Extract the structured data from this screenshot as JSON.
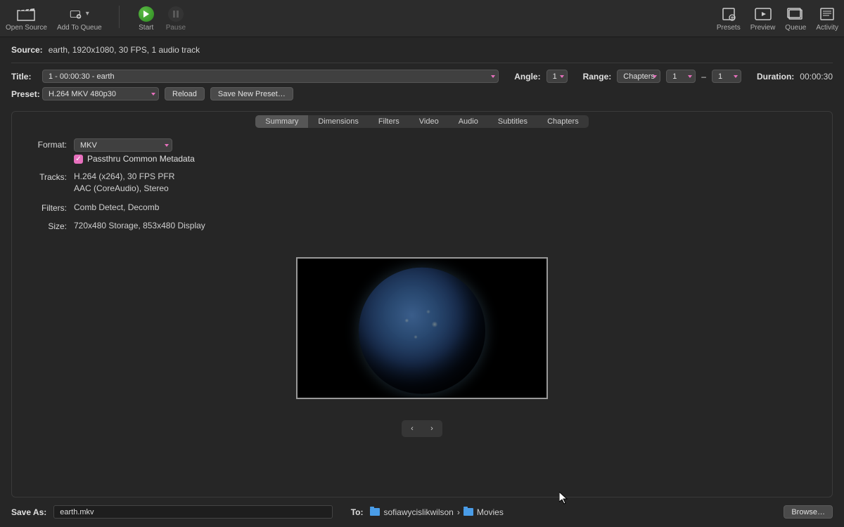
{
  "toolbar": {
    "open_source": "Open Source",
    "add_to_queue": "Add To Queue",
    "start": "Start",
    "pause": "Pause",
    "presets": "Presets",
    "preview": "Preview",
    "queue": "Queue",
    "activity": "Activity"
  },
  "source": {
    "label": "Source:",
    "value": "earth, 1920x1080, 30 FPS, 1 audio track"
  },
  "title": {
    "label": "Title:",
    "value": "1 - 00:00:30 - earth"
  },
  "angle": {
    "label": "Angle:",
    "value": "1"
  },
  "range": {
    "label": "Range:",
    "type": "Chapters",
    "from": "1",
    "to": "1",
    "sep": "–"
  },
  "duration": {
    "label": "Duration:",
    "value": "00:00:30"
  },
  "preset": {
    "label": "Preset:",
    "value": "H.264 MKV 480p30",
    "reload": "Reload",
    "save_new": "Save New Preset…"
  },
  "tabs": [
    "Summary",
    "Dimensions",
    "Filters",
    "Video",
    "Audio",
    "Subtitles",
    "Chapters"
  ],
  "active_tab": "Summary",
  "summary": {
    "format_label": "Format:",
    "format_value": "MKV",
    "passthru": "Passthru Common Metadata",
    "tracks_label": "Tracks:",
    "tracks_line1": "H.264 (x264), 30 FPS PFR",
    "tracks_line2": "AAC (CoreAudio), Stereo",
    "filters_label": "Filters:",
    "filters_value": "Comb Detect, Decomb",
    "size_label": "Size:",
    "size_value": "720x480 Storage, 853x480 Display"
  },
  "nav": {
    "prev": "‹",
    "next": "›"
  },
  "save": {
    "label": "Save As:",
    "filename": "earth.mkv",
    "to_label": "To:",
    "path_user": "sofiawycislikwilson",
    "path_sep": "›",
    "path_folder": "Movies",
    "browse": "Browse…"
  }
}
